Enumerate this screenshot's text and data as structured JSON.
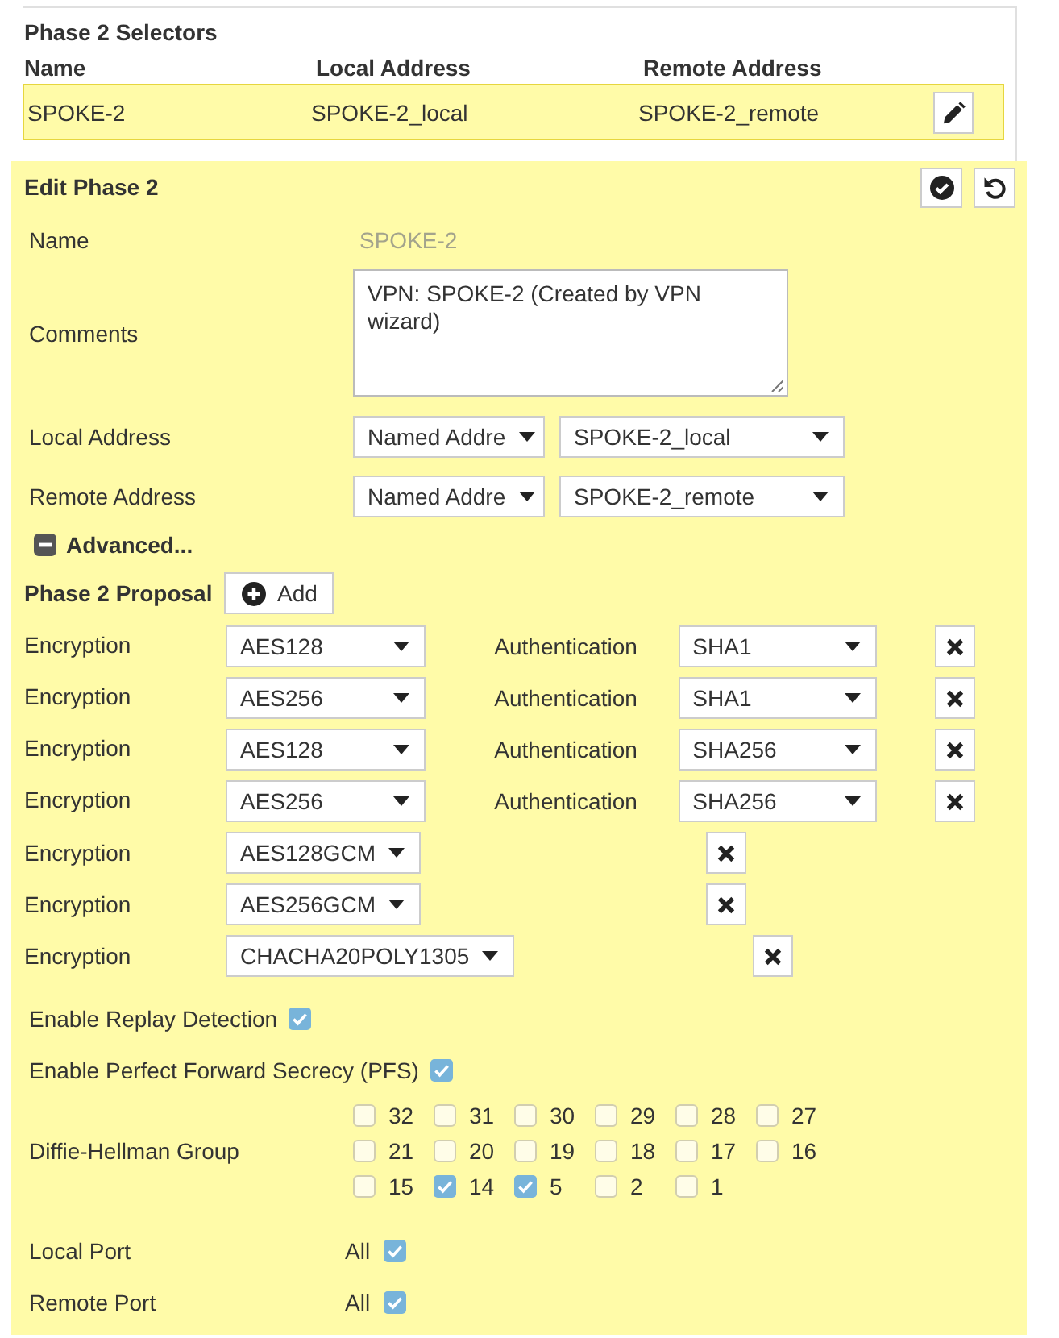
{
  "selectors": {
    "title": "Phase 2 Selectors",
    "columns": [
      "Name",
      "Local Address",
      "Remote Address"
    ],
    "rows": [
      {
        "name": "SPOKE-2",
        "local_address": "SPOKE-2_local",
        "remote_address": "SPOKE-2_remote",
        "selected": true
      }
    ]
  },
  "edit_phase2": {
    "title": "Edit Phase 2",
    "name": {
      "label": "Name",
      "value": "SPOKE-2",
      "disabled": true
    },
    "comments": {
      "label": "Comments",
      "value": "VPN: SPOKE-2 (Created by VPN wizard)"
    },
    "addresses": [
      {
        "label": "Local Address",
        "type": "Named Addre",
        "address": "SPOKE-2_local"
      },
      {
        "label": "Remote Address",
        "type": "Named Addre",
        "address": "SPOKE-2_remote"
      }
    ],
    "advanced": {
      "label": "Advanced...",
      "expanded": true
    },
    "proposal": {
      "label": "Phase 2 Proposal",
      "add_button": "Add",
      "items": [
        {
          "kind": "cipher_auth",
          "encryption_label": "Encryption",
          "encryption": "AES128",
          "authentication_label": "Authentication",
          "authentication": "SHA1"
        },
        {
          "kind": "cipher_auth",
          "encryption_label": "Encryption",
          "encryption": "AES256",
          "authentication_label": "Authentication",
          "authentication": "SHA1"
        },
        {
          "kind": "cipher_auth",
          "encryption_label": "Encryption",
          "encryption": "AES128",
          "authentication_label": "Authentication",
          "authentication": "SHA256"
        },
        {
          "kind": "cipher_auth",
          "encryption_label": "Encryption",
          "encryption": "AES256",
          "authentication_label": "Authentication",
          "authentication": "SHA256"
        },
        {
          "kind": "aead",
          "encryption_label": "Encryption",
          "encryption": "AES128GCM"
        },
        {
          "kind": "aead",
          "encryption_label": "Encryption",
          "encryption": "AES256GCM"
        },
        {
          "kind": "aead",
          "encryption_label": "Encryption",
          "encryption": "CHACHA20POLY1305"
        }
      ]
    },
    "options": [
      {
        "label": "Enable Replay Detection",
        "checked": true
      },
      {
        "label": "Enable Perfect Forward Secrecy (PFS)",
        "checked": true
      }
    ],
    "dh_group": {
      "label": "Diffie-Hellman Group",
      "options": [
        {
          "label": "32",
          "checked": false
        },
        {
          "label": "31",
          "checked": false
        },
        {
          "label": "30",
          "checked": false
        },
        {
          "label": "29",
          "checked": false
        },
        {
          "label": "28",
          "checked": false
        },
        {
          "label": "27",
          "checked": false
        },
        {
          "label": "21",
          "checked": false
        },
        {
          "label": "20",
          "checked": false
        },
        {
          "label": "19",
          "checked": false
        },
        {
          "label": "18",
          "checked": false
        },
        {
          "label": "17",
          "checked": false
        },
        {
          "label": "16",
          "checked": false
        },
        {
          "label": "15",
          "checked": false
        },
        {
          "label": "14",
          "checked": true
        },
        {
          "label": "5",
          "checked": true
        },
        {
          "label": "2",
          "checked": false
        },
        {
          "label": "1",
          "checked": false
        }
      ]
    },
    "ports": [
      {
        "label": "Local Port",
        "value": "All",
        "checked": true
      },
      {
        "label": "Remote Port",
        "value": "All",
        "checked": true
      }
    ]
  }
}
